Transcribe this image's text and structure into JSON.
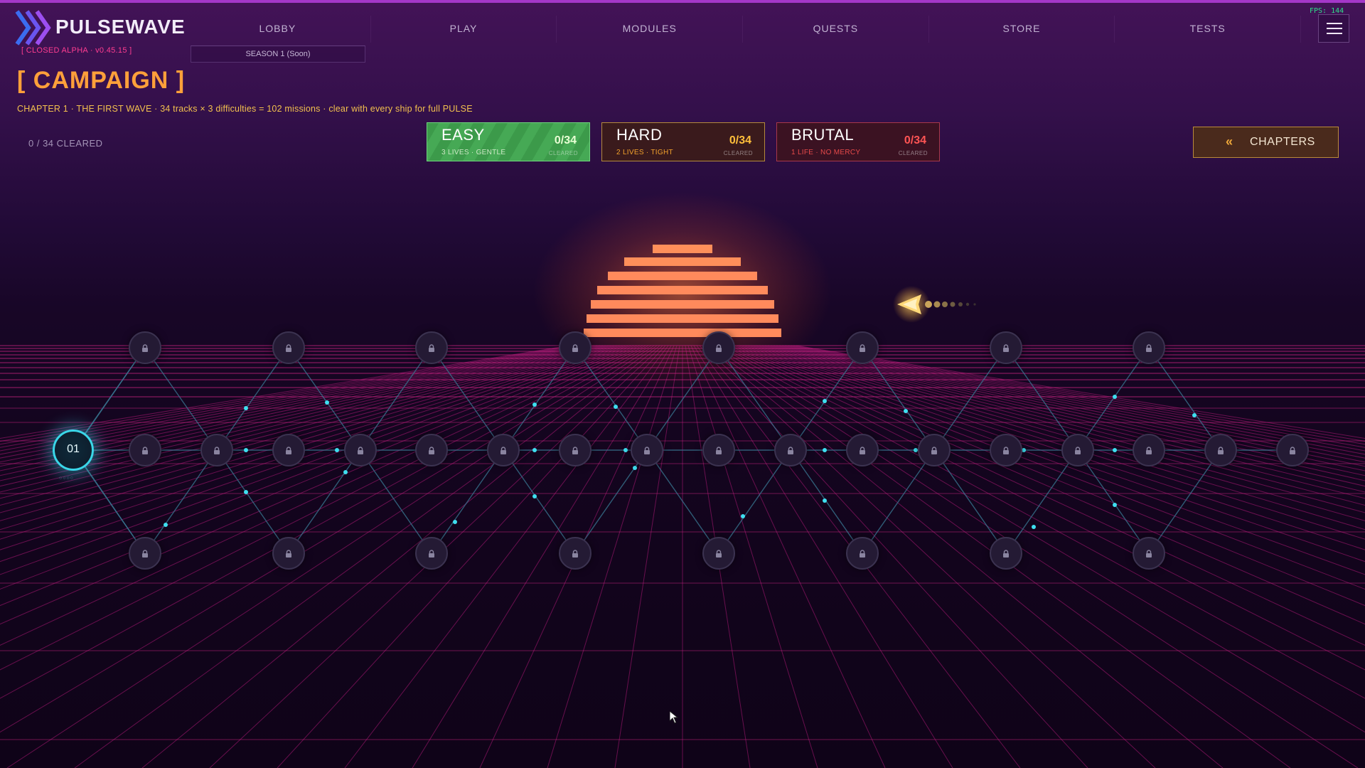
{
  "header": {
    "brand": "PULSEWAVE",
    "version": "[ CLOSED ALPHA · v0.45.15 ]",
    "nav": [
      "LOBBY",
      "PLAY",
      "MODULES",
      "QUESTS",
      "STORE",
      "TESTS"
    ],
    "season": "SEASON 1 (Soon)",
    "fps": "FPS: 144",
    "menu_icon": "hamburger-icon"
  },
  "campaign": {
    "title": "[ CAMPAIGN ]",
    "subtitle": "CHAPTER 1 · THE FIRST WAVE  ·  34 tracks × 3 difficulties = 102 missions · clear with every ship for full PULSE",
    "cleared": "0 / 34  CLEARED"
  },
  "difficulties": [
    {
      "name": "EASY",
      "sub": "3 LIVES · GENTLE",
      "count": "0/34",
      "cleared_label": "CLEARED",
      "color": "#46a955"
    },
    {
      "name": "HARD",
      "sub": "2 LIVES · TIGHT",
      "count": "0/34",
      "cleared_label": "CLEARED",
      "color": "#b48a3c"
    },
    {
      "name": "BRUTAL",
      "sub": "1 LIFE · NO MERCY",
      "count": "0/34",
      "cleared_label": "CLEARED",
      "color": "#a8384a"
    }
  ],
  "chapters_button": {
    "label": "CHAPTERS",
    "icon": "double-chevron-left-icon"
  },
  "map": {
    "start_label": "01",
    "start_pips": "○○○○",
    "node_icon": "lock-icon",
    "ship_icon": "ship-icon"
  },
  "colors": {
    "accent_orange": "#ffa03a",
    "accent_cyan": "#3ad6e8",
    "grid_pink": "#c2187e",
    "sun": "#ff8a5c"
  }
}
